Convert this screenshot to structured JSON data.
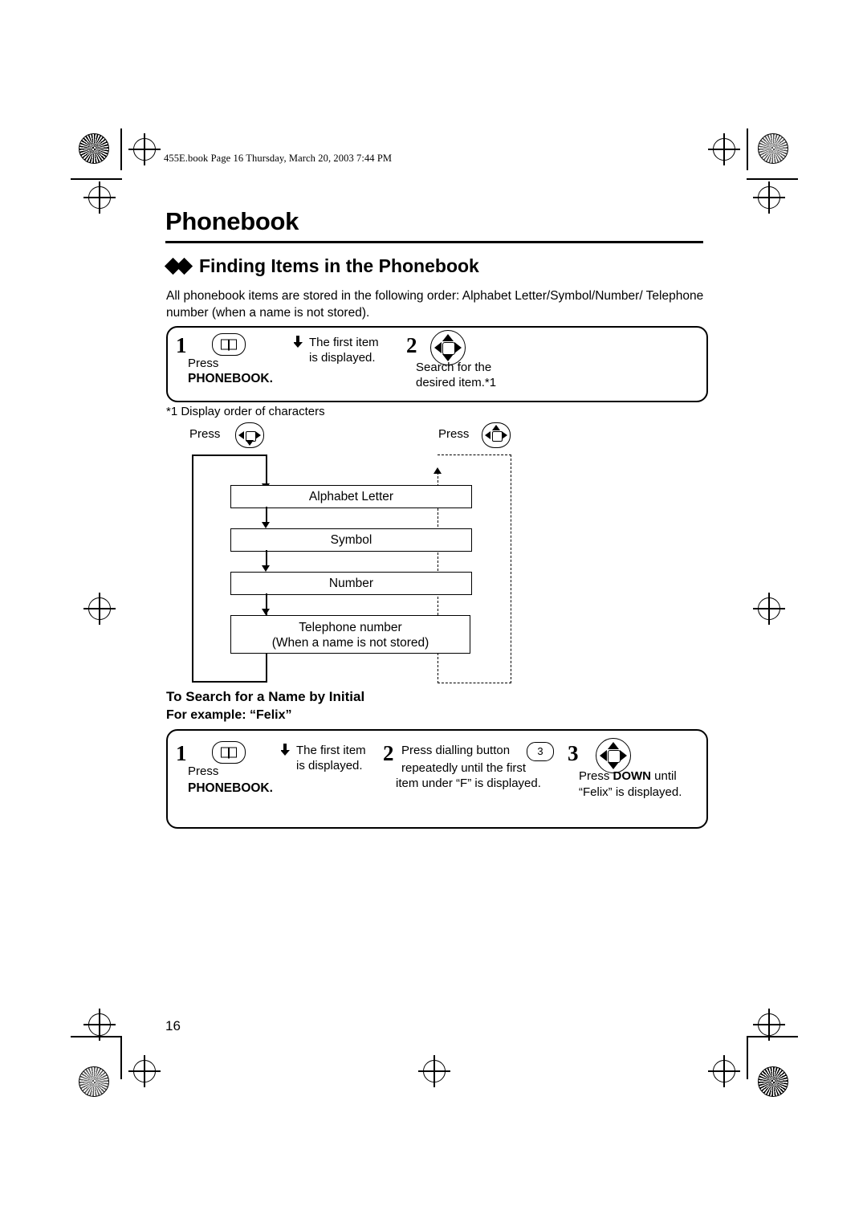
{
  "page": {
    "file_stamp": "455E.book  Page 16  Thursday, March 20, 2003  7:44 PM",
    "chapter_title": "Phonebook",
    "section_title": "Finding Items in the Phonebook",
    "intro": "All phonebook items are stored in the following order: Alphabet Letter/Symbol/Number/ Telephone number (when a name is not stored).",
    "page_number": "16"
  },
  "steps_top": [
    {
      "num": "1",
      "press_label": "Press",
      "key_label": "PHONEBOOK.",
      "result_line1": "The first item",
      "result_line2": "is displayed."
    },
    {
      "num": "2",
      "line1": "Search for the",
      "line2": "desired item.*1"
    }
  ],
  "footnote": "*1 Display order of characters",
  "flow": {
    "press_left_label": "Press",
    "press_right_label": "Press",
    "items": [
      "Alphabet Letter",
      "Symbol",
      "Number",
      "Telephone number"
    ],
    "telephone_sub": "(When a name is not stored)"
  },
  "subsection": {
    "heading": "To Search for a Name by Initial",
    "example": "For example: “Felix”"
  },
  "steps_bottom": [
    {
      "num": "1",
      "press_label": "Press",
      "key_label": "PHONEBOOK.",
      "result_line1": "The first item",
      "result_line2": "is displayed."
    },
    {
      "num": "2",
      "line1": "Press dialling button",
      "dial_key": "3",
      "line2": "repeatedly until the first",
      "line3": "item under “F” is displayed."
    },
    {
      "num": "3",
      "line1_pre": "Press ",
      "line1_bold": "DOWN",
      "line1_post": " until",
      "line2": "“Felix” is displayed."
    }
  ]
}
